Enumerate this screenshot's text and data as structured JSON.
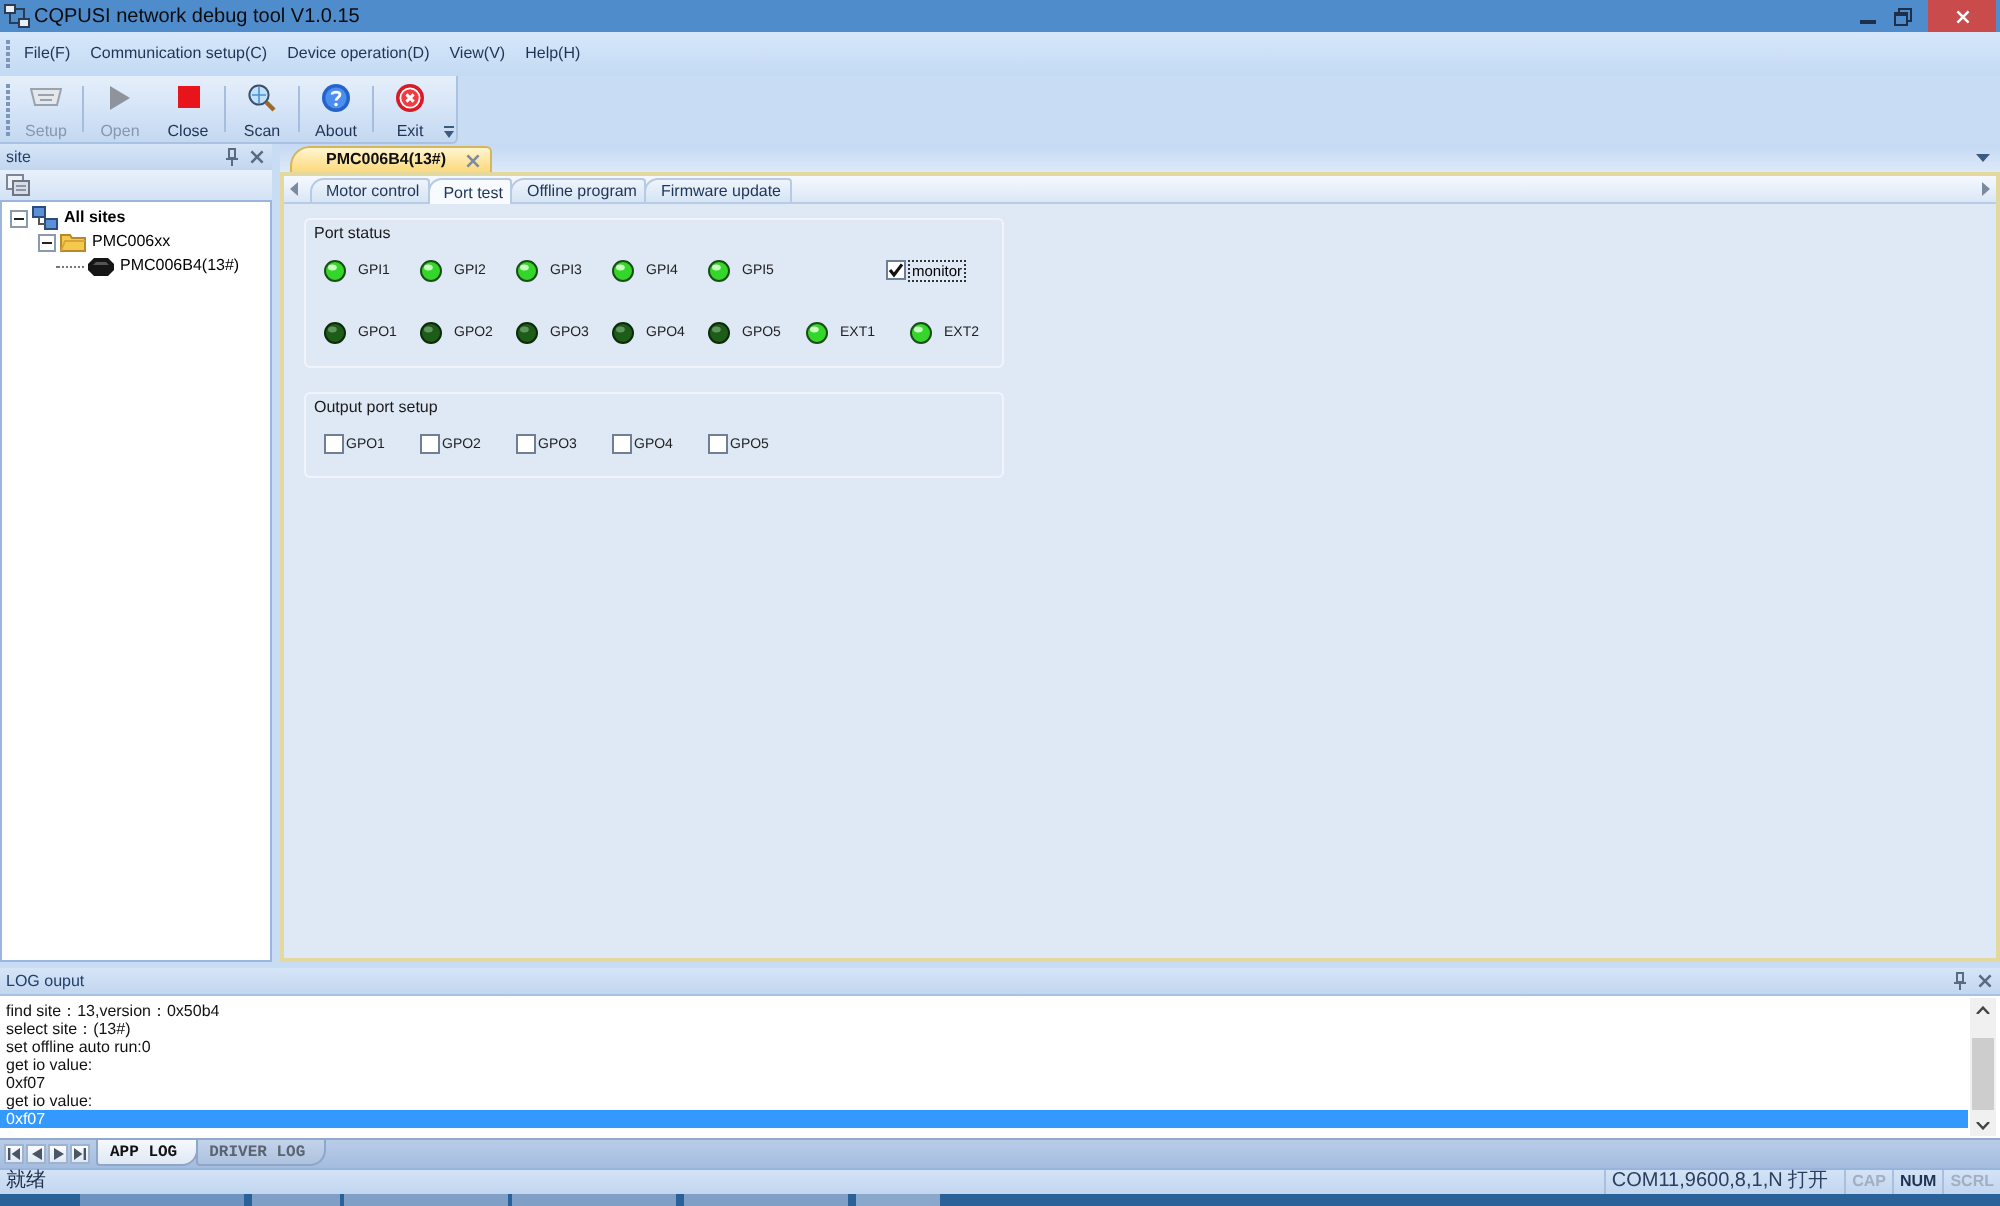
{
  "window": {
    "title": "CQPUSI network debug tool V1.0.15"
  },
  "menu": [
    "File(F)",
    "Communication setup(C)",
    "Device operation(D)",
    "View(V)",
    "Help(H)"
  ],
  "toolbar": [
    {
      "label": "Setup",
      "disabled": true
    },
    {
      "label": "Open",
      "disabled": true
    },
    {
      "label": "Close",
      "disabled": false
    },
    {
      "label": "Scan",
      "disabled": false
    },
    {
      "label": "About",
      "disabled": false
    },
    {
      "label": "Exit",
      "disabled": false
    }
  ],
  "site_panel": {
    "title": "site",
    "tree": [
      {
        "label": "All sites",
        "expanded": true,
        "children": [
          {
            "label": "PMC006xx",
            "expanded": true,
            "children": [
              {
                "label": "PMC006B4(13#)"
              }
            ]
          }
        ]
      }
    ]
  },
  "document_tabs": [
    {
      "label": "PMC006B4(13#)",
      "selected": true
    }
  ],
  "tabs": [
    {
      "label": "Motor control",
      "selected": false
    },
    {
      "label": "Port test",
      "selected": true
    },
    {
      "label": "Offline program",
      "selected": false
    },
    {
      "label": "Firmware update",
      "selected": false
    }
  ],
  "port_status": {
    "title": "Port status",
    "inputs": [
      {
        "label": "GPI1",
        "on": true
      },
      {
        "label": "GPI2",
        "on": true
      },
      {
        "label": "GPI3",
        "on": true
      },
      {
        "label": "GPI4",
        "on": true
      },
      {
        "label": "GPI5",
        "on": true
      }
    ],
    "monitor": {
      "label": "monitor",
      "checked": true
    },
    "outputs": [
      {
        "label": "GPO1",
        "on": false
      },
      {
        "label": "GPO2",
        "on": false
      },
      {
        "label": "GPO3",
        "on": false
      },
      {
        "label": "GPO4",
        "on": false
      },
      {
        "label": "GPO5",
        "on": false
      },
      {
        "label": "EXT1",
        "on": true
      },
      {
        "label": "EXT2",
        "on": true
      }
    ]
  },
  "output_port_setup": {
    "title": "Output port setup",
    "ports": [
      {
        "label": "GPO1",
        "checked": false
      },
      {
        "label": "GPO2",
        "checked": false
      },
      {
        "label": "GPO3",
        "checked": false
      },
      {
        "label": "GPO4",
        "checked": false
      },
      {
        "label": "GPO5",
        "checked": false
      }
    ]
  },
  "log_panel": {
    "title": "LOG ouput",
    "lines": [
      {
        "text": "find site：13,version：0x50b4",
        "selected": false
      },
      {
        "text": "select site：(13#)",
        "selected": false
      },
      {
        "text": "set offline auto run:0",
        "selected": false
      },
      {
        "text": "get io value:",
        "selected": false
      },
      {
        "text": "0xf07",
        "selected": false
      },
      {
        "text": "get io value:",
        "selected": false
      },
      {
        "text": "0xf07",
        "selected": true
      }
    ],
    "tabs": [
      {
        "label": "APP LOG",
        "selected": true
      },
      {
        "label": "DRIVER LOG",
        "selected": false
      }
    ]
  },
  "status_bar": {
    "message": "就绪",
    "port": "COM11,9600,8,1,N 打开",
    "indicators": [
      {
        "label": "CAP",
        "on": false
      },
      {
        "label": "NUM",
        "on": true
      },
      {
        "label": "SCRL",
        "on": false
      }
    ]
  }
}
